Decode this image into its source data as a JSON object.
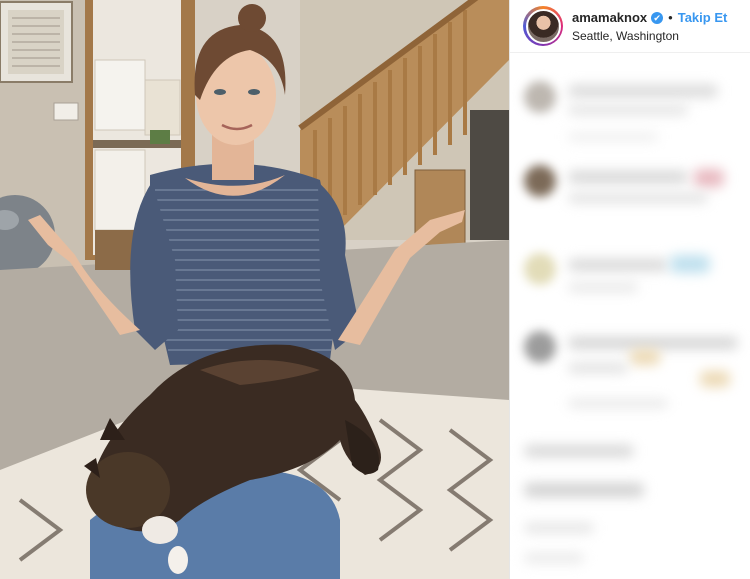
{
  "post": {
    "username": "amamaknox",
    "verified_glyph": "✔",
    "separator": "•",
    "follow_label": "Takip Et",
    "location": "Seattle, Washington"
  },
  "icons": {
    "verified": "verified-badge-icon"
  },
  "colors": {
    "link_blue": "#3897f0",
    "text_dark": "#262626",
    "divider": "#efefef"
  }
}
